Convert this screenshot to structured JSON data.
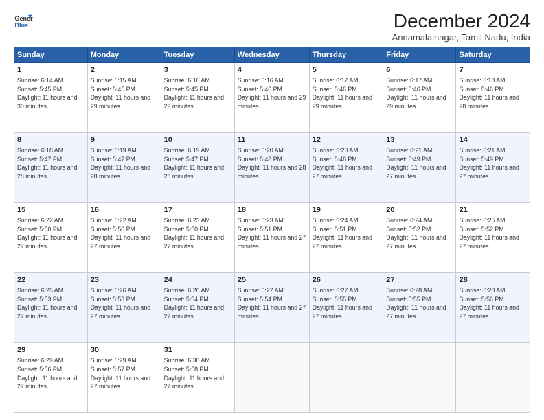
{
  "header": {
    "logo_line1": "General",
    "logo_line2": "Blue",
    "title": "December 2024",
    "subtitle": "Annamalainagar, Tamil Nadu, India"
  },
  "days_of_week": [
    "Sunday",
    "Monday",
    "Tuesday",
    "Wednesday",
    "Thursday",
    "Friday",
    "Saturday"
  ],
  "weeks": [
    [
      {
        "day": 1,
        "sunrise": "6:14 AM",
        "sunset": "5:45 PM",
        "daylight": "11 hours and 30 minutes."
      },
      {
        "day": 2,
        "sunrise": "6:15 AM",
        "sunset": "5:45 PM",
        "daylight": "11 hours and 29 minutes."
      },
      {
        "day": 3,
        "sunrise": "6:16 AM",
        "sunset": "5:45 PM",
        "daylight": "11 hours and 29 minutes."
      },
      {
        "day": 4,
        "sunrise": "6:16 AM",
        "sunset": "5:46 PM",
        "daylight": "11 hours and 29 minutes."
      },
      {
        "day": 5,
        "sunrise": "6:17 AM",
        "sunset": "5:46 PM",
        "daylight": "11 hours and 29 minutes."
      },
      {
        "day": 6,
        "sunrise": "6:17 AM",
        "sunset": "5:46 PM",
        "daylight": "11 hours and 29 minutes."
      },
      {
        "day": 7,
        "sunrise": "6:18 AM",
        "sunset": "5:46 PM",
        "daylight": "11 hours and 28 minutes."
      }
    ],
    [
      {
        "day": 8,
        "sunrise": "6:18 AM",
        "sunset": "5:47 PM",
        "daylight": "11 hours and 28 minutes."
      },
      {
        "day": 9,
        "sunrise": "6:19 AM",
        "sunset": "5:47 PM",
        "daylight": "11 hours and 28 minutes."
      },
      {
        "day": 10,
        "sunrise": "6:19 AM",
        "sunset": "5:47 PM",
        "daylight": "11 hours and 28 minutes."
      },
      {
        "day": 11,
        "sunrise": "6:20 AM",
        "sunset": "5:48 PM",
        "daylight": "11 hours and 28 minutes."
      },
      {
        "day": 12,
        "sunrise": "6:20 AM",
        "sunset": "5:48 PM",
        "daylight": "11 hours and 27 minutes."
      },
      {
        "day": 13,
        "sunrise": "6:21 AM",
        "sunset": "5:49 PM",
        "daylight": "11 hours and 27 minutes."
      },
      {
        "day": 14,
        "sunrise": "6:21 AM",
        "sunset": "5:49 PM",
        "daylight": "11 hours and 27 minutes."
      }
    ],
    [
      {
        "day": 15,
        "sunrise": "6:22 AM",
        "sunset": "5:50 PM",
        "daylight": "11 hours and 27 minutes."
      },
      {
        "day": 16,
        "sunrise": "6:22 AM",
        "sunset": "5:50 PM",
        "daylight": "11 hours and 27 minutes."
      },
      {
        "day": 17,
        "sunrise": "6:23 AM",
        "sunset": "5:50 PM",
        "daylight": "11 hours and 27 minutes."
      },
      {
        "day": 18,
        "sunrise": "6:23 AM",
        "sunset": "5:51 PM",
        "daylight": "11 hours and 27 minutes."
      },
      {
        "day": 19,
        "sunrise": "6:24 AM",
        "sunset": "5:51 PM",
        "daylight": "11 hours and 27 minutes."
      },
      {
        "day": 20,
        "sunrise": "6:24 AM",
        "sunset": "5:52 PM",
        "daylight": "11 hours and 27 minutes."
      },
      {
        "day": 21,
        "sunrise": "6:25 AM",
        "sunset": "5:52 PM",
        "daylight": "11 hours and 27 minutes."
      }
    ],
    [
      {
        "day": 22,
        "sunrise": "6:25 AM",
        "sunset": "5:53 PM",
        "daylight": "11 hours and 27 minutes."
      },
      {
        "day": 23,
        "sunrise": "6:26 AM",
        "sunset": "5:53 PM",
        "daylight": "11 hours and 27 minutes."
      },
      {
        "day": 24,
        "sunrise": "6:26 AM",
        "sunset": "5:54 PM",
        "daylight": "11 hours and 27 minutes."
      },
      {
        "day": 25,
        "sunrise": "6:27 AM",
        "sunset": "5:54 PM",
        "daylight": "11 hours and 27 minutes."
      },
      {
        "day": 26,
        "sunrise": "6:27 AM",
        "sunset": "5:55 PM",
        "daylight": "11 hours and 27 minutes."
      },
      {
        "day": 27,
        "sunrise": "6:28 AM",
        "sunset": "5:55 PM",
        "daylight": "11 hours and 27 minutes."
      },
      {
        "day": 28,
        "sunrise": "6:28 AM",
        "sunset": "5:56 PM",
        "daylight": "11 hours and 27 minutes."
      }
    ],
    [
      {
        "day": 29,
        "sunrise": "6:29 AM",
        "sunset": "5:56 PM",
        "daylight": "11 hours and 27 minutes."
      },
      {
        "day": 30,
        "sunrise": "6:29 AM",
        "sunset": "5:57 PM",
        "daylight": "11 hours and 27 minutes."
      },
      {
        "day": 31,
        "sunrise": "6:30 AM",
        "sunset": "5:58 PM",
        "daylight": "11 hours and 27 minutes."
      },
      null,
      null,
      null,
      null
    ]
  ]
}
